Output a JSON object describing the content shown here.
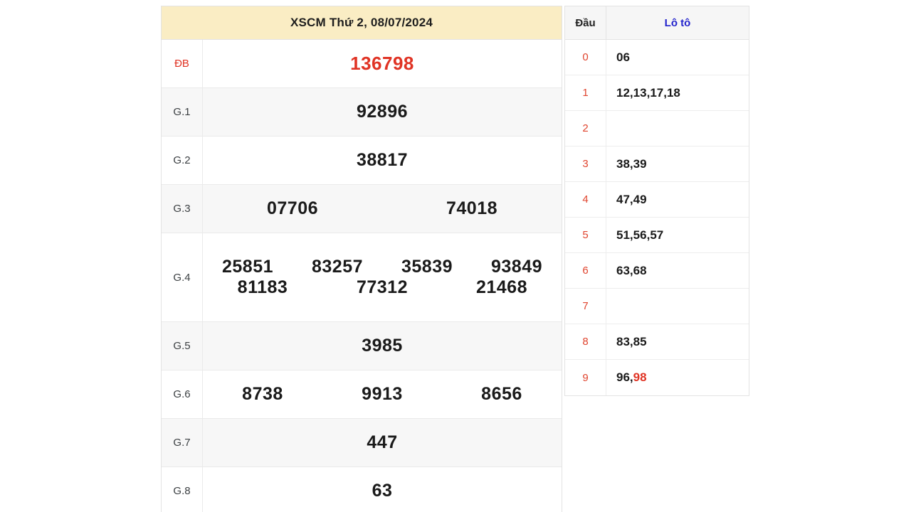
{
  "header": {
    "title": "XSCM Thứ 2, 08/07/2024"
  },
  "prizes": [
    {
      "label": "ĐB",
      "special": true,
      "lines": [
        [
          "136798"
        ]
      ]
    },
    {
      "label": "G.1",
      "special": false,
      "lines": [
        [
          "92896"
        ]
      ]
    },
    {
      "label": "G.2",
      "special": false,
      "lines": [
        [
          "38817"
        ]
      ]
    },
    {
      "label": "G.3",
      "special": false,
      "lines": [
        [
          "07706",
          "74018"
        ]
      ]
    },
    {
      "label": "G.4",
      "special": false,
      "lines": [
        [
          "25851",
          "83257",
          "35839",
          "93849"
        ],
        [
          "81183",
          "77312",
          "21468"
        ]
      ]
    },
    {
      "label": "G.5",
      "special": false,
      "lines": [
        [
          "3985"
        ]
      ]
    },
    {
      "label": "G.6",
      "special": false,
      "lines": [
        [
          "8738",
          "9913",
          "8656"
        ]
      ]
    },
    {
      "label": "G.7",
      "special": false,
      "lines": [
        [
          "447"
        ]
      ]
    },
    {
      "label": "G.8",
      "special": false,
      "lines": [
        [
          "63"
        ]
      ]
    }
  ],
  "loto": {
    "head_dau": "Đầu",
    "head_loto": "Lô tô",
    "rows": [
      {
        "dau": "0",
        "numbers": [
          "06"
        ],
        "highlight": []
      },
      {
        "dau": "1",
        "numbers": [
          "12",
          "13",
          "17",
          "18"
        ],
        "highlight": []
      },
      {
        "dau": "2",
        "numbers": [],
        "highlight": []
      },
      {
        "dau": "3",
        "numbers": [
          "38",
          "39"
        ],
        "highlight": []
      },
      {
        "dau": "4",
        "numbers": [
          "47",
          "49"
        ],
        "highlight": []
      },
      {
        "dau": "5",
        "numbers": [
          "51",
          "56",
          "57"
        ],
        "highlight": []
      },
      {
        "dau": "6",
        "numbers": [
          "63",
          "68"
        ],
        "highlight": []
      },
      {
        "dau": "7",
        "numbers": [],
        "highlight": []
      },
      {
        "dau": "8",
        "numbers": [
          "83",
          "85"
        ],
        "highlight": []
      },
      {
        "dau": "9",
        "numbers": [
          "96",
          "98"
        ],
        "highlight": [
          "98"
        ]
      }
    ]
  },
  "colors": {
    "header_bg": "#faedc4",
    "special_red": "#e03324",
    "dau_red": "#e0452f",
    "loto_blue": "#2222cc",
    "row_alt_bg": "#f7f7f7",
    "border": "#e3e3e3"
  }
}
